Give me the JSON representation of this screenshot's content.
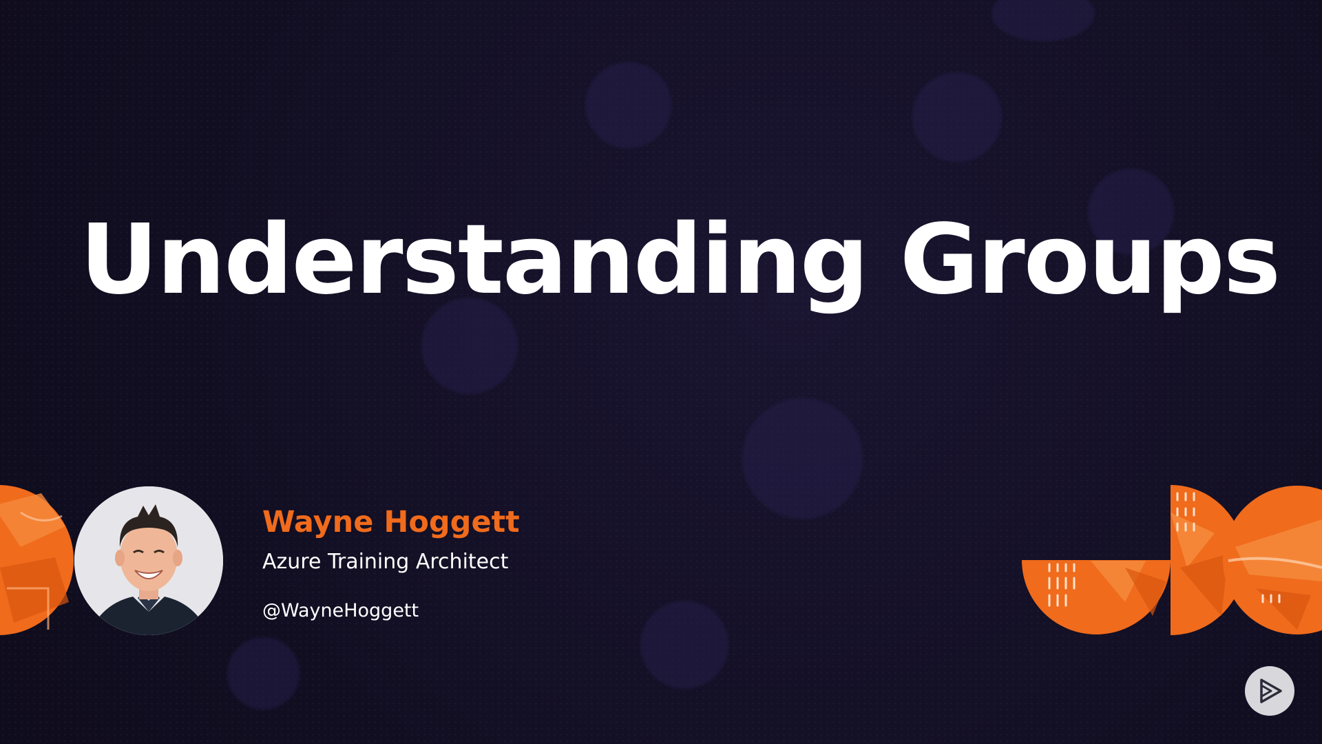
{
  "slide": {
    "title": "Understanding Groups",
    "presenter": {
      "name": "Wayne Hoggett",
      "role": "Azure Training Architect",
      "handle": "@WayneHoggett"
    },
    "icons": {
      "avatar": "presenter-photo",
      "logo": "play-logo-icon"
    },
    "colors": {
      "background": "#130f24",
      "accent": "#f06b1c",
      "text": "#ffffff"
    }
  }
}
